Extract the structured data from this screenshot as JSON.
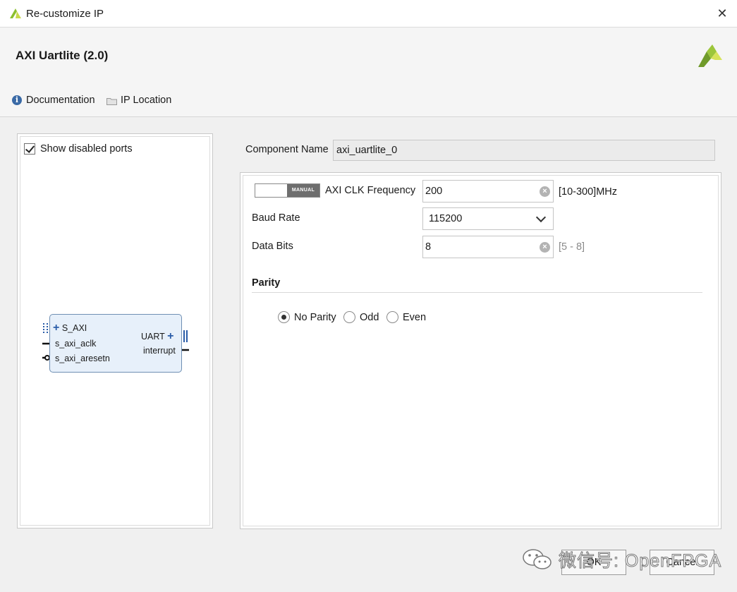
{
  "window": {
    "title": "Re-customize IP",
    "close_glyph": "✕"
  },
  "header": {
    "ip_title": "AXI Uartlite (2.0)"
  },
  "toolbar": {
    "documentation": "Documentation",
    "ip_location": "IP Location"
  },
  "left_panel": {
    "show_disabled_ports": "Show disabled ports",
    "show_disabled_ports_checked": true,
    "block": {
      "s_axi": "S_AXI",
      "s_axi_aclk": "s_axi_aclk",
      "s_axi_aresetn": "s_axi_aresetn",
      "uart": "UART",
      "interrupt": "interrupt"
    }
  },
  "config": {
    "component_name_label": "Component Name",
    "component_name_value": "axi_uartlite_0",
    "manual_toggle": "MANUAL",
    "axi_clk_label": "AXI CLK Frequency",
    "axi_clk_value": "200",
    "axi_clk_range": "[10-300]MHz",
    "baud_label": "Baud Rate",
    "baud_value": "115200",
    "data_bits_label": "Data Bits",
    "data_bits_value": "8",
    "data_bits_range": "[5 - 8]",
    "parity_title": "Parity",
    "parity_options": [
      "No Parity",
      "Odd",
      "Even"
    ],
    "parity_selected": "No Parity"
  },
  "buttons": {
    "ok": "OK",
    "cancel": "Cancel"
  },
  "watermark": "微信号: OpenFPGA",
  "colors": {
    "accent": "#2a5ca8",
    "brand_green": "#8bbf2e",
    "block_fill": "#e7f0fa"
  }
}
